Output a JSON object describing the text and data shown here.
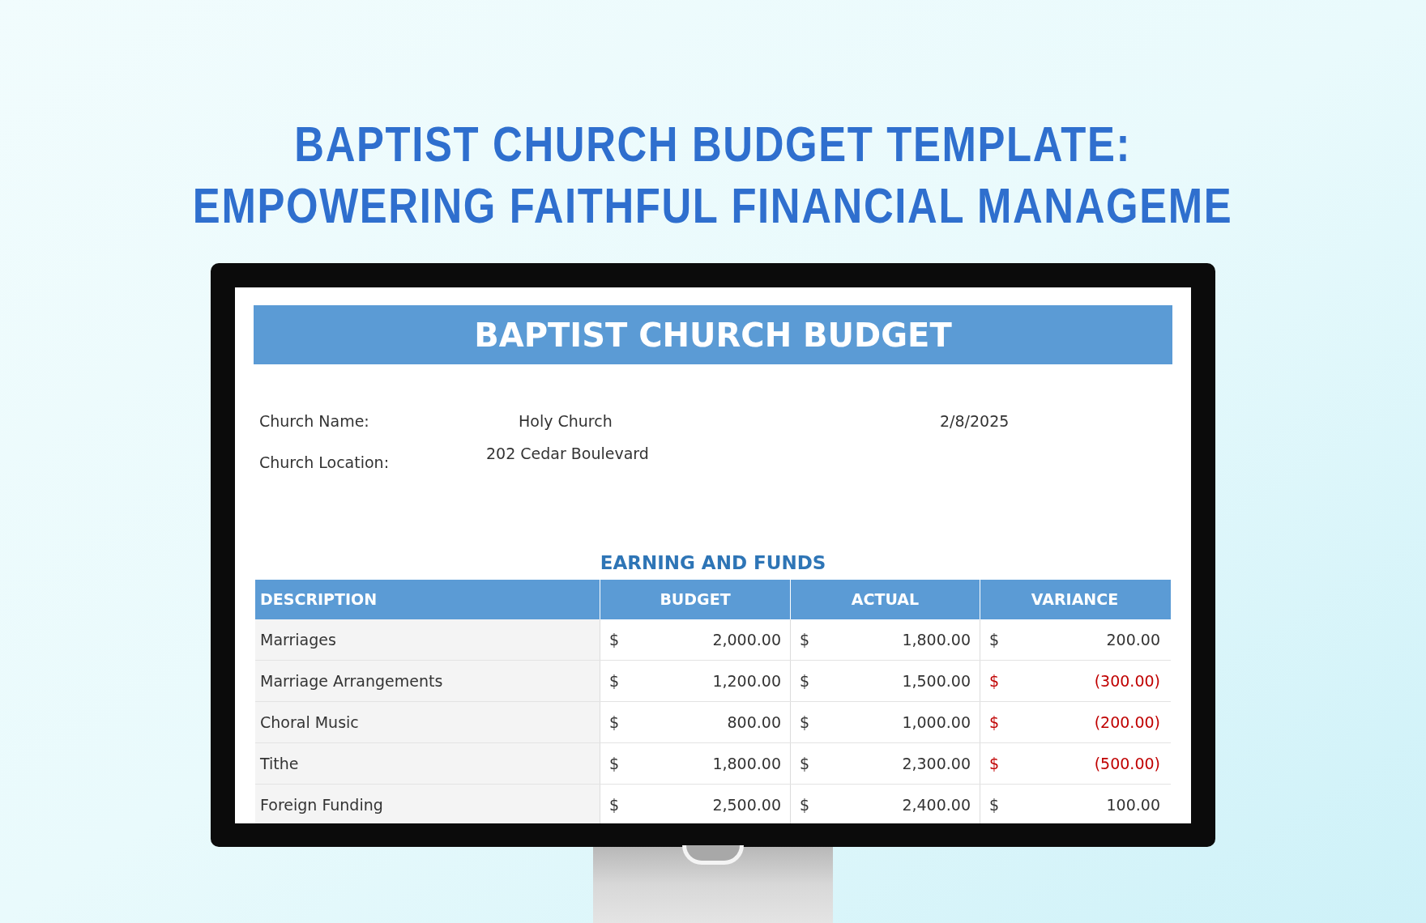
{
  "headline": [
    "BAPTIST CHURCH BUDGET TEMPLATE:",
    "EMPOWERING FAITHFUL FINANCIAL MANAGEME"
  ],
  "sheet": {
    "title": "BAPTIST CHURCH BUDGET",
    "info": [
      {
        "label": "Church Name:",
        "value": "Holy Church",
        "extra": "2/8/2025"
      },
      {
        "label": "Church Location:",
        "value": "202 Cedar Boulevard"
      }
    ],
    "section": "EARNING AND FUNDS",
    "columns": [
      "DESCRIPTION",
      "BUDGET",
      "ACTUAL",
      "VARIANCE"
    ],
    "rows": [
      {
        "description": "Marriages",
        "budget": [
          "$",
          "2,000.00"
        ],
        "actual": [
          "$",
          "1,800.00"
        ],
        "variance": [
          "$",
          "200.00"
        ],
        "negative": false
      },
      {
        "description": "Marriage Arrangements",
        "budget": [
          "$",
          "1,200.00"
        ],
        "actual": [
          "$",
          "1,500.00"
        ],
        "variance": [
          "$",
          "(300.00)"
        ],
        "negative": true
      },
      {
        "description": "Choral Music",
        "budget": [
          "$",
          "800.00"
        ],
        "actual": [
          "$",
          "1,000.00"
        ],
        "variance": [
          "$",
          "(200.00)"
        ],
        "negative": true
      },
      {
        "description": "Tithe",
        "budget": [
          "$",
          "1,800.00"
        ],
        "actual": [
          "$",
          "2,300.00"
        ],
        "variance": [
          "$",
          "(500.00)"
        ],
        "negative": true
      },
      {
        "description": "Foreign Funding",
        "budget": [
          "$",
          "2,500.00"
        ],
        "actual": [
          "$",
          "2,400.00"
        ],
        "variance": [
          "$",
          "100.00"
        ],
        "negative": false
      }
    ]
  }
}
